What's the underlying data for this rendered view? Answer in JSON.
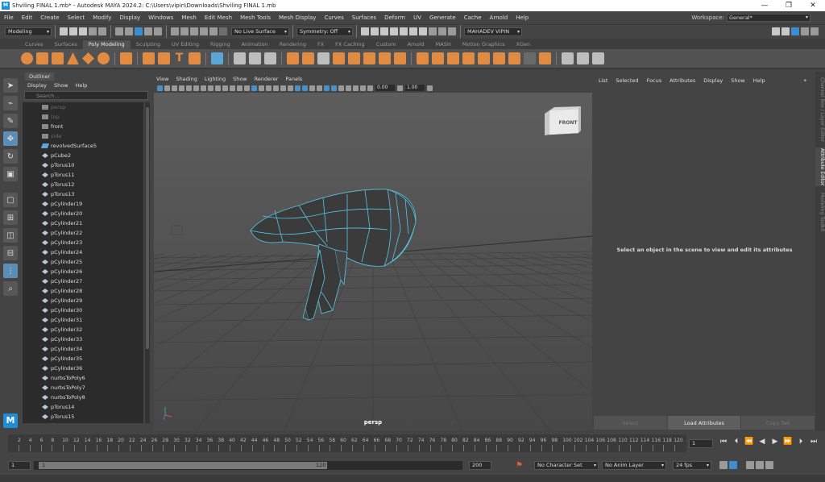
{
  "window": {
    "title": "Shviling FINAL 1.mb* - Autodesk MAYA 2024.2: C:\\Users\\vipin\\Downloads\\Shviling FINAL 1.mb",
    "minimize": "—",
    "restore": "❐",
    "close": "✕"
  },
  "menubar": {
    "items": [
      "File",
      "Edit",
      "Create",
      "Select",
      "Modify",
      "Display",
      "Windows",
      "Mesh",
      "Edit Mesh",
      "Mesh Tools",
      "Mesh Display",
      "Curves",
      "Surfaces",
      "Deform",
      "UV",
      "Generate",
      "Cache",
      "Arnold",
      "Help"
    ],
    "workspace_label": "Workspace:",
    "workspace_value": "General*"
  },
  "statusline": {
    "mode": "Modeling",
    "live_surface": "No Live Surface",
    "symmetry": "Symmetry: Off",
    "user": "MAHADEV VIPIN"
  },
  "shelf": {
    "tabs": [
      "Curves",
      "Surfaces",
      "Poly Modeling",
      "Sculpting",
      "UV Editing",
      "Rigging",
      "Animation",
      "Rendering",
      "FX",
      "FX Caching",
      "Custom",
      "Arnold",
      "MASH",
      "Motion Graphics",
      "XGen"
    ],
    "active_tab": "Poly Modeling"
  },
  "outliner": {
    "tab": "Outliner",
    "menu": [
      "Display",
      "Show",
      "Help"
    ],
    "search_placeholder": "Search...",
    "items": [
      {
        "label": "persp",
        "type": "camera",
        "dim": true
      },
      {
        "label": "top",
        "type": "camera",
        "dim": true
      },
      {
        "label": "front",
        "type": "camera",
        "dim": false
      },
      {
        "label": "side",
        "type": "camera",
        "dim": true
      },
      {
        "label": "revolvedSurface5",
        "type": "surface",
        "dim": false
      },
      {
        "label": "pCube2",
        "type": "mesh",
        "dim": false
      },
      {
        "label": "pTorus10",
        "type": "mesh",
        "dim": false
      },
      {
        "label": "pTorus11",
        "type": "mesh",
        "dim": false
      },
      {
        "label": "pTorus12",
        "type": "mesh",
        "dim": false
      },
      {
        "label": "pTorus13",
        "type": "mesh",
        "dim": false
      },
      {
        "label": "pCylinder19",
        "type": "mesh",
        "dim": false
      },
      {
        "label": "pCylinder20",
        "type": "mesh",
        "dim": false
      },
      {
        "label": "pCylinder21",
        "type": "mesh",
        "dim": false
      },
      {
        "label": "pCylinder22",
        "type": "mesh",
        "dim": false
      },
      {
        "label": "pCylinder23",
        "type": "mesh",
        "dim": false
      },
      {
        "label": "pCylinder24",
        "type": "mesh",
        "dim": false
      },
      {
        "label": "pCylinder25",
        "type": "mesh",
        "dim": false
      },
      {
        "label": "pCylinder26",
        "type": "mesh",
        "dim": false
      },
      {
        "label": "pCylinder27",
        "type": "mesh",
        "dim": false
      },
      {
        "label": "pCylinder28",
        "type": "mesh",
        "dim": false
      },
      {
        "label": "pCylinder29",
        "type": "mesh",
        "dim": false
      },
      {
        "label": "pCylinder30",
        "type": "mesh",
        "dim": false
      },
      {
        "label": "pCylinder31",
        "type": "mesh",
        "dim": false
      },
      {
        "label": "pCylinder32",
        "type": "mesh",
        "dim": false
      },
      {
        "label": "pCylinder33",
        "type": "mesh",
        "dim": false
      },
      {
        "label": "pCylinder34",
        "type": "mesh",
        "dim": false
      },
      {
        "label": "pCylinder35",
        "type": "mesh",
        "dim": false
      },
      {
        "label": "pCylinder36",
        "type": "mesh",
        "dim": false
      },
      {
        "label": "nurbsToPoly6",
        "type": "mesh",
        "dim": false
      },
      {
        "label": "nurbsToPoly7",
        "type": "mesh",
        "dim": false
      },
      {
        "label": "nurbsToPoly8",
        "type": "mesh",
        "dim": false
      },
      {
        "label": "pTorus14",
        "type": "mesh",
        "dim": false
      },
      {
        "label": "pTorus15",
        "type": "mesh",
        "dim": false
      }
    ]
  },
  "viewport": {
    "menu": [
      "View",
      "Shading",
      "Lighting",
      "Show",
      "Renderer",
      "Panels"
    ],
    "near_value": "0.00",
    "far_value": "1.00",
    "camera_label": "persp",
    "viewcube_label": "FRONT",
    "background_color": "#6b6b6b",
    "wire_color": "#55c8e6"
  },
  "attribute_editor": {
    "menu": [
      "List",
      "Selected",
      "Focus",
      "Attributes",
      "Display",
      "Show",
      "Help"
    ],
    "message": "Select an object in the scene to view and edit its attributes",
    "buttons": [
      "Select",
      "Load Attributes",
      "Copy Tab"
    ]
  },
  "side_tabs": [
    "Channel Box / Layer Editor",
    "Attribute Editor",
    "Modeling Toolkit"
  ],
  "timeline": {
    "ticks": [
      "2",
      "4",
      "6",
      "8",
      "10",
      "12",
      "14",
      "16",
      "18",
      "20",
      "22",
      "24",
      "26",
      "28",
      "30",
      "32",
      "34",
      "36",
      "38",
      "40",
      "42",
      "44",
      "46",
      "48",
      "50",
      "52",
      "54",
      "56",
      "58",
      "60",
      "62",
      "64",
      "66",
      "68",
      "70",
      "72",
      "74",
      "76",
      "78",
      "80",
      "82",
      "84",
      "86",
      "88",
      "90",
      "92",
      "94",
      "96",
      "98",
      "100",
      "102",
      "104",
      "106",
      "108",
      "110",
      "112",
      "114",
      "116",
      "118",
      "120"
    ],
    "current_frame": "1"
  },
  "range": {
    "start": "1",
    "inner_start": "1",
    "inner_end": "120",
    "end": "200",
    "character_set": "No Character Set",
    "anim_layer": "No Anim Layer",
    "fps": "24 fps"
  }
}
